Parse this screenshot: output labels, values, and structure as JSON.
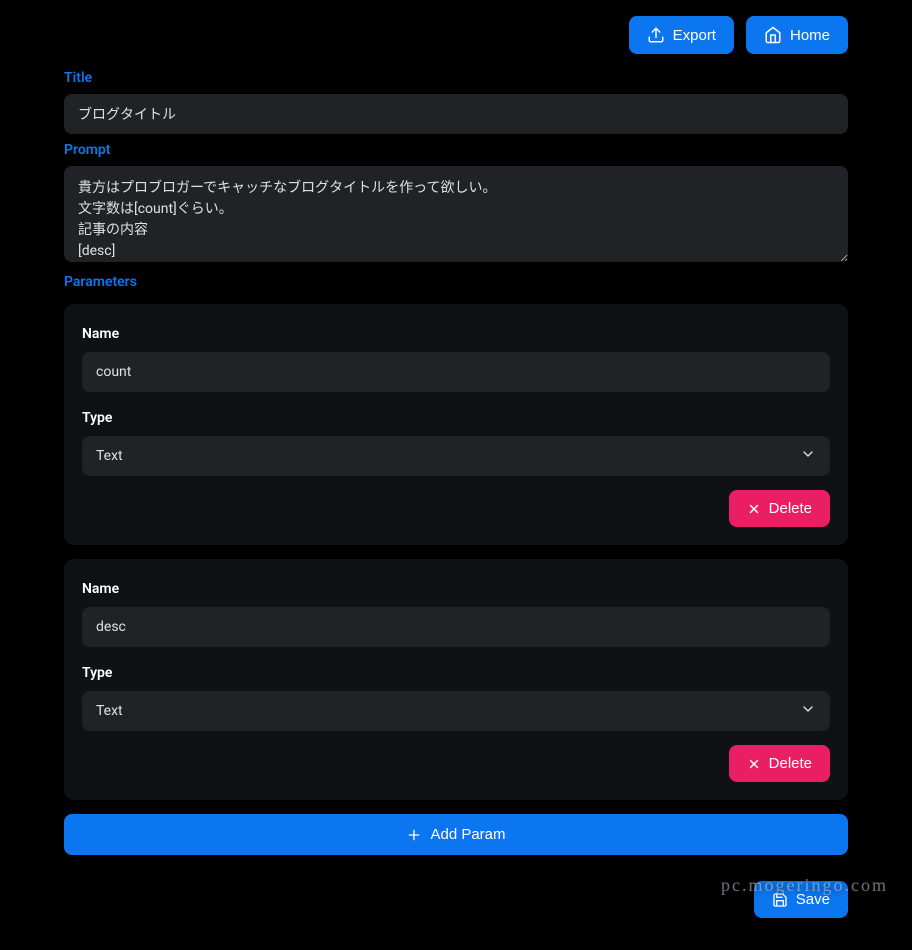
{
  "header": {
    "export_label": "Export",
    "home_label": "Home"
  },
  "labels": {
    "title": "Title",
    "prompt": "Prompt",
    "parameters": "Parameters",
    "name": "Name",
    "type": "Type"
  },
  "form": {
    "title_value": "ブログタイトル",
    "prompt_value": "貴方はプロブロガーでキャッチなブログタイトルを作って欲しい。\n文字数は[count]ぐらい。\n記事の内容\n[desc]"
  },
  "parameters": [
    {
      "name": "count",
      "type": "Text"
    },
    {
      "name": "desc",
      "type": "Text"
    }
  ],
  "buttons": {
    "delete": "Delete",
    "add_param": "Add Param",
    "save": "Save"
  },
  "watermark": "pc.mogeringo.com"
}
